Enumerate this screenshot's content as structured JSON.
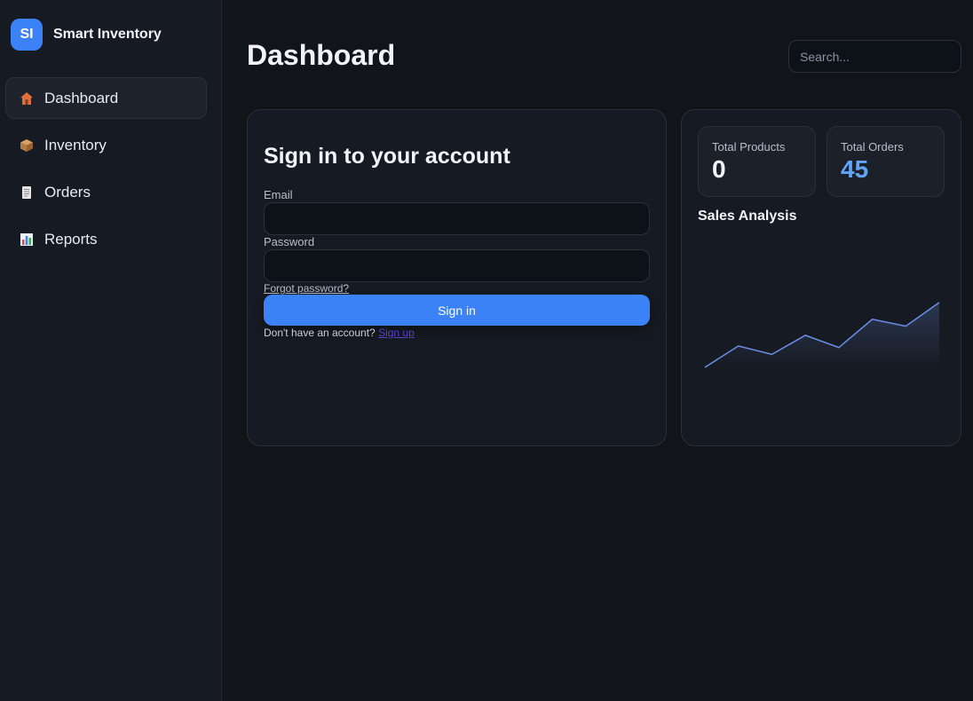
{
  "sidebar": {
    "brand": {
      "initials": "SI",
      "name": "Smart Inventory"
    },
    "items": [
      {
        "label": "Dashboard",
        "icon": "house-icon",
        "active": true
      },
      {
        "label": "Inventory",
        "icon": "package-icon",
        "active": false
      },
      {
        "label": "Orders",
        "icon": "receipt-icon",
        "active": false
      },
      {
        "label": "Reports",
        "icon": "bar-chart-icon",
        "active": false
      }
    ]
  },
  "header": {
    "title": "Dashboard",
    "search_placeholder": "Search..."
  },
  "login": {
    "title": "Sign in to your account",
    "email_label": "Email",
    "email_value": "",
    "password_label": "Password",
    "password_value": "",
    "forgot_label": "Forgot password?",
    "signin_label": "Sign in",
    "signup_prompt": "Don't have an account?",
    "signup_label": "Sign up"
  },
  "stats": {
    "total_products": {
      "label": "Total Products",
      "value": "0"
    },
    "total_orders": {
      "label": "Total Orders",
      "value": "45"
    }
  },
  "sales": {
    "title": "Sales Analysis"
  },
  "chart_data": {
    "type": "area",
    "title": "Sales Analysis",
    "x": [
      1,
      2,
      3,
      4,
      5,
      6,
      7,
      8
    ],
    "values": [
      0,
      28,
      17,
      42,
      26,
      63,
      54,
      85
    ],
    "ylim": [
      0,
      100
    ],
    "xlabel": "",
    "ylabel": "",
    "grid": false,
    "color": "#6d8fe8"
  },
  "colors": {
    "accent": "#3b82f6",
    "orders_value": "#60a5fa",
    "background": "#111419",
    "card": "#161a22"
  }
}
